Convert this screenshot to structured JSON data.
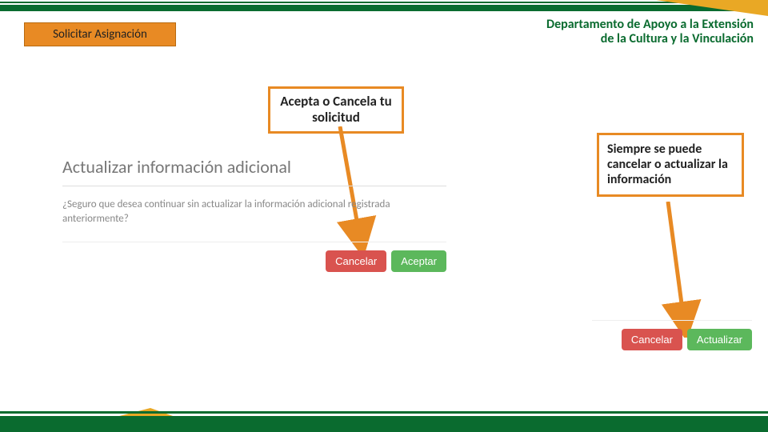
{
  "header": {
    "page_title": "Solicitar Asignación",
    "department_line1": "Departamento de Apoyo a la Extensión",
    "department_line2": "de la Cultura y la Vinculación"
  },
  "callouts": {
    "accept_cancel": "Acepta o Cancela tu solicitud",
    "always_cancel": "Siempre se puede cancelar o actualizar la información"
  },
  "dialog": {
    "title": "Actualizar información adicional",
    "body": "¿Seguro que desea continuar sin actualizar la información adicional registrada anteriormente?",
    "cancel": "Cancelar",
    "accept": "Aceptar"
  },
  "secondary_actions": {
    "cancel": "Cancelar",
    "update": "Actualizar"
  }
}
